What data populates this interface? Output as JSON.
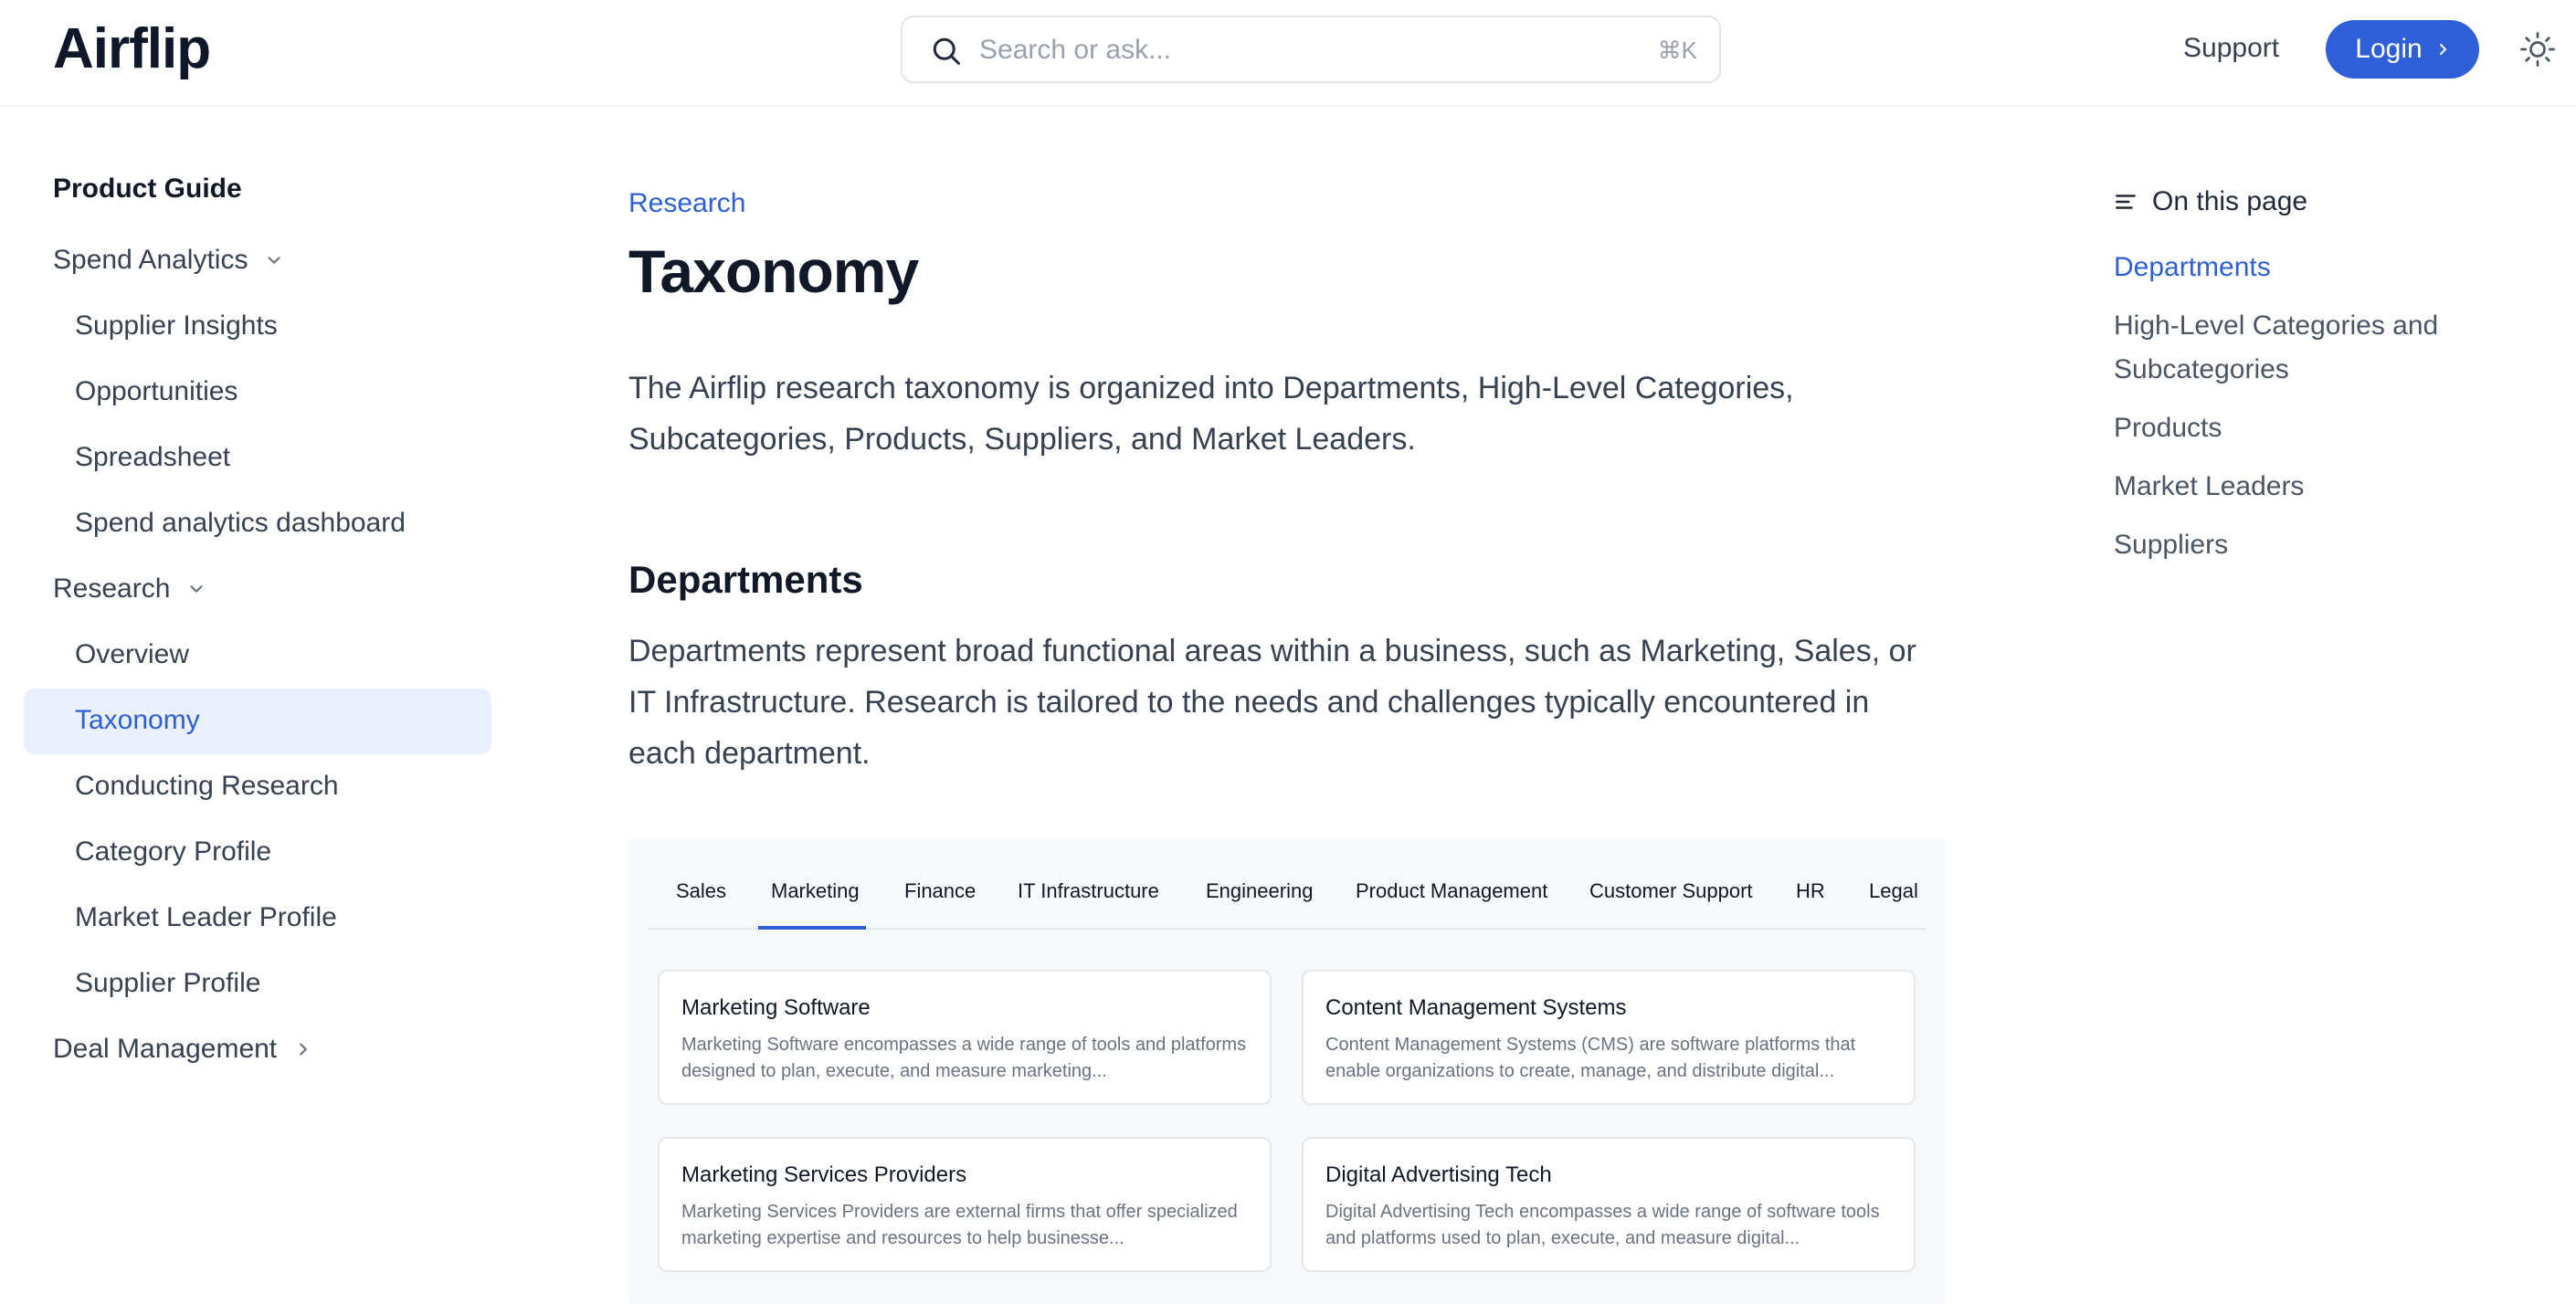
{
  "header": {
    "logo": "Airflip",
    "search_placeholder": "Search or ask...",
    "search_shortcut": "⌘K",
    "support_label": "Support",
    "login_label": "Login"
  },
  "sidebar": {
    "title": "Product Guide",
    "items": [
      {
        "label": "Spend Analytics",
        "level": 0,
        "expanded": true
      },
      {
        "label": "Supplier Insights",
        "level": 1
      },
      {
        "label": "Opportunities",
        "level": 1
      },
      {
        "label": "Spreadsheet",
        "level": 1
      },
      {
        "label": "Spend analytics dashboard",
        "level": 1
      },
      {
        "label": "Research",
        "level": 0,
        "expanded": true
      },
      {
        "label": "Overview",
        "level": 1
      },
      {
        "label": "Taxonomy",
        "level": 1,
        "active": true
      },
      {
        "label": "Conducting Research",
        "level": 1
      },
      {
        "label": "Category Profile",
        "level": 1
      },
      {
        "label": "Market Leader Profile",
        "level": 1
      },
      {
        "label": "Supplier Profile",
        "level": 1
      },
      {
        "label": "Deal Management",
        "level": 0,
        "expanded": false
      }
    ]
  },
  "main": {
    "breadcrumb": "Research",
    "title": "Taxonomy",
    "intro": "The Airflip research taxonomy is organized into Departments, High-Level Categories, Subcategories, Products, Suppliers, and Market Leaders.",
    "section_heading": "Departments",
    "section_text": "Departments represent broad functional areas within a business, such as Marketing, Sales, or IT Infrastructure. Research is tailored to the needs and challenges typically encountered in each department.",
    "tabs": [
      "Sales",
      "Marketing",
      "Finance",
      "IT Infrastructure",
      "Engineering",
      "Product Management",
      "Customer Support",
      "HR",
      "Legal"
    ],
    "active_tab": "Marketing",
    "cards": [
      {
        "title": "Marketing Software",
        "desc": "Marketing Software encompasses a wide range of tools and platforms designed to plan, execute, and measure marketing..."
      },
      {
        "title": "Content Management Systems",
        "desc": "Content Management Systems (CMS) are software platforms that enable organizations to create, manage, and distribute digital..."
      },
      {
        "title": "Marketing Services Providers",
        "desc": "Marketing Services Providers are external firms that offer specialized marketing expertise and resources to help businesse..."
      },
      {
        "title": "Digital Advertising Tech",
        "desc": "Digital Advertising Tech encompasses a wide range of software tools and platforms used to plan, execute, and measure digital..."
      }
    ]
  },
  "toc": {
    "heading": "On this page",
    "items": [
      {
        "label": "Departments",
        "active": true
      },
      {
        "label": "High-Level Categories and Subcategories"
      },
      {
        "label": "Products"
      },
      {
        "label": "Market Leaders"
      },
      {
        "label": "Suppliers"
      }
    ]
  },
  "colors": {
    "accent": "#2f5fd8",
    "active_bg": "#e9effc",
    "text": "#374151",
    "heading": "#111827",
    "muted": "#9aa1ad"
  }
}
